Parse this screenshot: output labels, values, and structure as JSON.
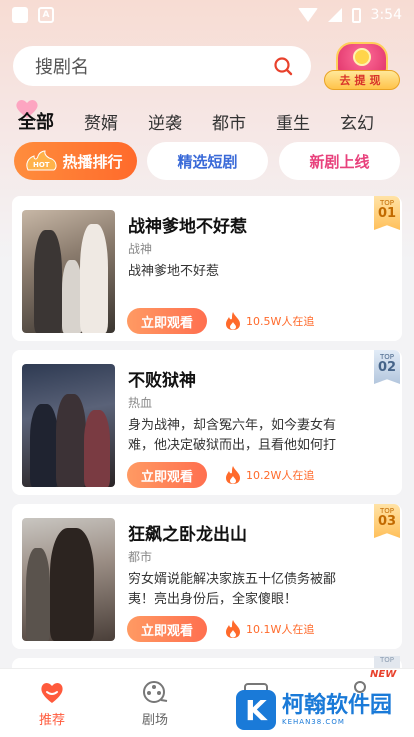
{
  "status_bar": {
    "time": "3:54"
  },
  "search": {
    "placeholder": "搜剧名"
  },
  "gift": {
    "label": "去提现"
  },
  "tabs": [
    "全部",
    "赘婿",
    "逆袭",
    "都市",
    "重生",
    "玄幻"
  ],
  "pills": {
    "hot": "热播排行",
    "hot_badge": "HOT",
    "selected": "精选短剧",
    "new": "新剧上线"
  },
  "dramas": [
    {
      "rank_label": "TOP",
      "rank": "01",
      "title": "战神爹地不好惹",
      "genre": "战神",
      "desc": "战神爹地不好惹",
      "watch": "立即观看",
      "follow": "10.5W人在追"
    },
    {
      "rank_label": "TOP",
      "rank": "02",
      "title": "不败狱神",
      "genre": "热血",
      "desc": "身为战神，却含冤六年，如今妻女有难，他决定破狱而出，且看他如何打",
      "watch": "立即观看",
      "follow": "10.2W人在追"
    },
    {
      "rank_label": "TOP",
      "rank": "03",
      "title": "狂飙之卧龙出山",
      "genre": "都市",
      "desc": "穷女婿说能解决家族五十亿债务被鄙夷！亮出身份后，全家傻眼！",
      "watch": "立即观看",
      "follow": "10.1W人在追"
    }
  ],
  "next_rank_label": "TOP",
  "bottom_nav": {
    "recommend": "推荐",
    "theater": "剧场",
    "new_tag": "NEW"
  },
  "watermark": {
    "mark": "K",
    "name": "柯翰软件园",
    "url": "KEHAN38.COM"
  },
  "colors": {
    "accent": "#ff6a2b",
    "pill_blue": "#3a6ad8",
    "pill_pink": "#e8417c"
  }
}
